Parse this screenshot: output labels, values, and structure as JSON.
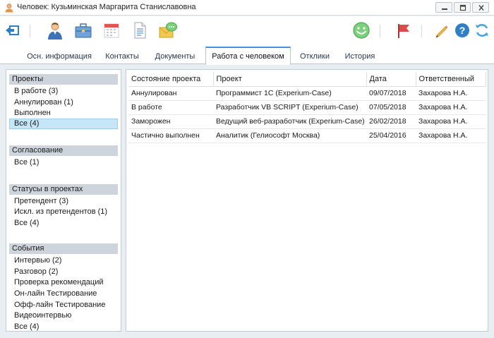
{
  "window": {
    "title": "Человек: Кузьминская Маргарита Станиславовна"
  },
  "toolbar": {
    "icons": [
      "back-icon",
      "person-icon",
      "briefcase-icon",
      "calendar-icon",
      "document-icon",
      "message-icon",
      "smiley-icon",
      "flag-icon",
      "pencil-icon",
      "help-icon",
      "refresh-icon"
    ]
  },
  "tabs": [
    {
      "label": "Осн. информация"
    },
    {
      "label": "Контакты"
    },
    {
      "label": "Документы"
    },
    {
      "label": "Работа с человеком"
    },
    {
      "label": "Отклики"
    },
    {
      "label": "История"
    }
  ],
  "sections": {
    "projects": {
      "header": "Проекты",
      "items": [
        "В работе (3)",
        "Аннулирован (1)",
        "Выполнен",
        "Все (4)"
      ]
    },
    "approval": {
      "header": "Согласование",
      "items": [
        "Все (1)"
      ]
    },
    "statuses": {
      "header": "Статусы в проектах",
      "items": [
        "Претендент (3)",
        "Искл. из претендентов (1)",
        "Все (4)"
      ]
    },
    "events": {
      "header": "События",
      "items": [
        "Интервью (2)",
        "Разговор (2)",
        "Проверка рекомендаций",
        "Он-лайн Тестирование",
        "Офф-лайн Тестирование",
        "Видеоинтервью",
        "Все (4)"
      ]
    }
  },
  "table": {
    "columns": [
      "Состояние проекта",
      "Проект",
      "Дата",
      "Ответственный"
    ],
    "rows": [
      [
        "Аннулирован",
        "Программист 1С (Experium-Case)",
        "09/07/2018",
        "Захарова Н.А."
      ],
      [
        "В работе",
        "Разработчик VB SCRIPT (Experium-Case)",
        "07/05/2018",
        "Захарова Н.А."
      ],
      [
        "Заморожен",
        "Ведущий веб-разработчик (Experium-Case)",
        "26/02/2018",
        "Захарова Н.А."
      ],
      [
        "Частично выполнен",
        "Аналитик (Гелиософт Москва)",
        "25/04/2016",
        "Захарова Н.А."
      ]
    ]
  },
  "colors": {
    "accent": "#4a90d9",
    "selected_bg": "#c6e6f8",
    "section_header_bg": "#cdd4db",
    "window_bg": "#e9eef3"
  }
}
